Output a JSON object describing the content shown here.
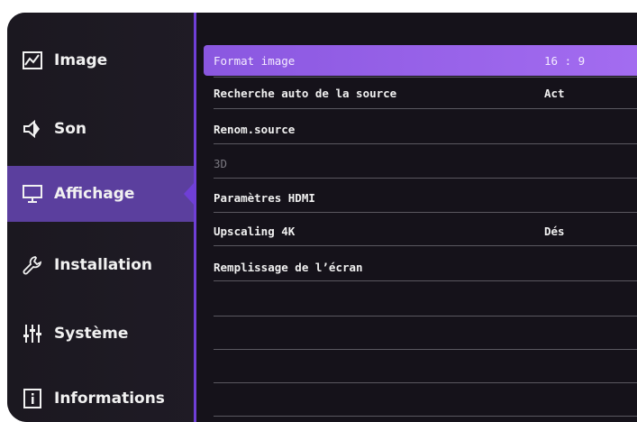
{
  "sidebar": {
    "items": [
      {
        "label": "Image",
        "icon": "image-chart-icon"
      },
      {
        "label": "Son",
        "icon": "speaker-icon"
      },
      {
        "label": "Affichage",
        "icon": "monitor-icon"
      },
      {
        "label": "Installation",
        "icon": "wrench-icon"
      },
      {
        "label": "Système",
        "icon": "sliders-icon"
      },
      {
        "label": "Informations",
        "icon": "info-icon"
      }
    ],
    "active_index": 2
  },
  "menu": {
    "rows": [
      {
        "label": "Format image",
        "value": "16 : 9"
      },
      {
        "label": "Recherche auto de la source",
        "value": "Act"
      },
      {
        "label": "Renom.source",
        "value": ""
      },
      {
        "label": "3D",
        "value": ""
      },
      {
        "label": "Paramètres HDMI",
        "value": ""
      },
      {
        "label": "Upscaling 4K",
        "value": "Dés"
      },
      {
        "label": "Remplissage de l’écran",
        "value": ""
      }
    ]
  },
  "colors": {
    "accent": "#8a57e0",
    "active_sidebar": "#5b3f9e",
    "background": "#15121a"
  }
}
